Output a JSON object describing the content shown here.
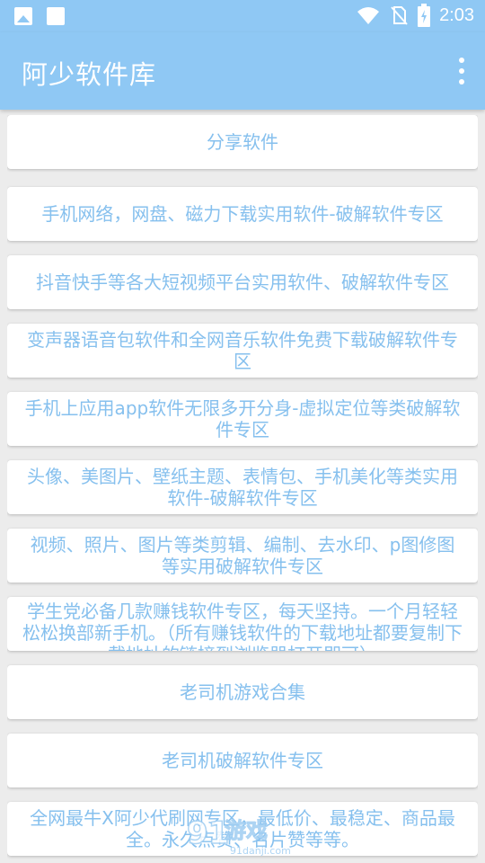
{
  "status_bar": {
    "time": "2:03"
  },
  "app_bar": {
    "title": "阿少软件库"
  },
  "items": [
    "分享软件",
    "手机网络，网盘、磁力下载实用软件-破解软件专区",
    "抖音快手等各大短视频平台实用软件、破解软件专区",
    "变声器语音包软件和全网音乐软件免费下载破解软件专区",
    "手机上应用app软件无限多开分身-虚拟定位等类破解软件专区",
    "头像、美图片、壁纸主题、表情包、手机美化等类实用软件-破解软件专区",
    "视频、照片、图片等类剪辑、编制、去水印、p图修图等实用破解软件专区",
    "学生党必备几款赚钱软件专区，每天坚持。一个月轻轻松松换部新手机。（所有赚钱软件的下载地址都要复制下载地址的链接到浏览器打开即可）",
    "老司机游戏合集",
    "老司机破解软件专区",
    "全网最牛X阿少代刷网专区，最低价、最稳定、商品最全。永久点赞、名片赞等等。"
  ],
  "watermark": {
    "text": "91游戏",
    "url": "91danji.com"
  },
  "colors": {
    "primary": "#8fc8f4",
    "item_text": "#86c0ee",
    "background": "#ececec"
  },
  "icons": [
    "image-notification-icon",
    "square-notification-icon",
    "wifi-icon",
    "no-sim-icon",
    "battery-charging-icon",
    "more-vert-icon"
  ]
}
